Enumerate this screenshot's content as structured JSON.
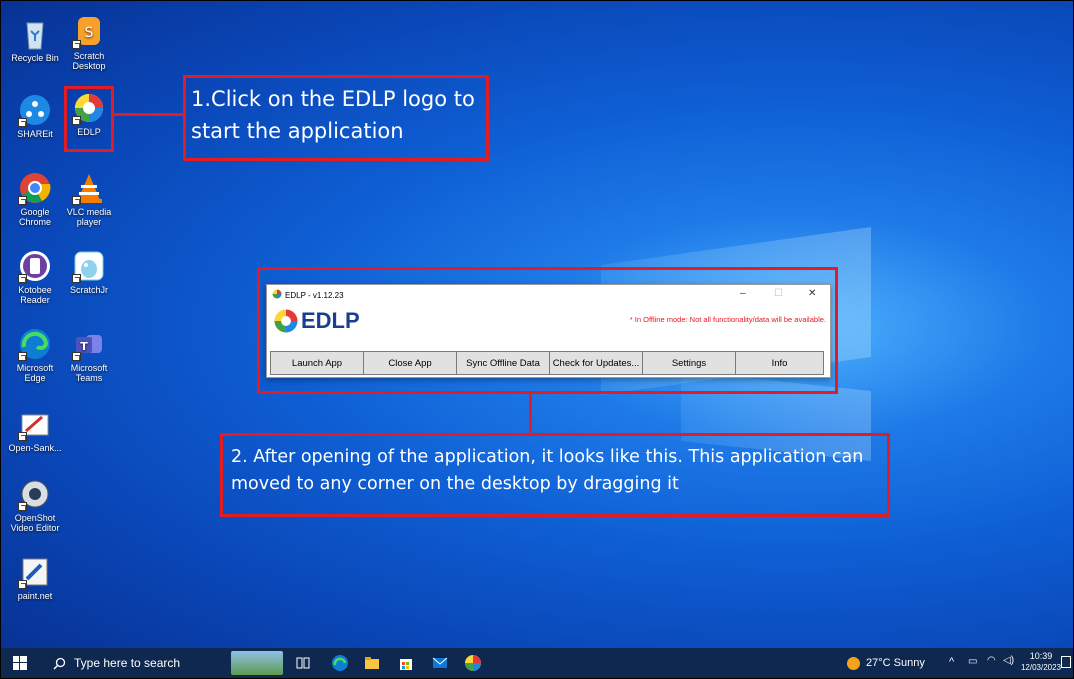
{
  "desktop_icons": [
    {
      "label": "Recycle Bin"
    },
    {
      "label": "Scratch Desktop"
    },
    {
      "label": "SHAREit"
    },
    {
      "label": "EDLP"
    },
    {
      "label": "Google Chrome"
    },
    {
      "label": "VLC media player"
    },
    {
      "label": "Kotobee Reader"
    },
    {
      "label": "ScratchJr"
    },
    {
      "label": "Microsoft Edge"
    },
    {
      "label": "Microsoft Teams"
    },
    {
      "label": "Open-Sank..."
    },
    {
      "label": "OpenShot Video Editor"
    },
    {
      "label": "paint.net"
    }
  ],
  "callouts": {
    "step1": "1.Click on the EDLP logo to start the application",
    "step2": "2. After opening of the application, it looks like this. This application can moved to any corner on the desktop by dragging it"
  },
  "app_window": {
    "title": "EDLP - v1.12.23",
    "logo_text": "EDLP",
    "offline_notice": "* In Offline mode: Not all functionality/data will be available.",
    "buttons": [
      "Launch App",
      "Close App",
      "Sync Offline Data",
      "Check for Updates...",
      "Settings",
      "Info"
    ],
    "minimize": "–",
    "maximize": "☐",
    "close": "✕"
  },
  "taskbar": {
    "search_placeholder": "Type here to search",
    "weather": "27°C  Sunny",
    "time": "10:39",
    "date": "12/03/2023"
  },
  "colors": {
    "callout_red": "#e31b23",
    "notice_red": "#e31b23",
    "taskbar": "#0f2850"
  }
}
